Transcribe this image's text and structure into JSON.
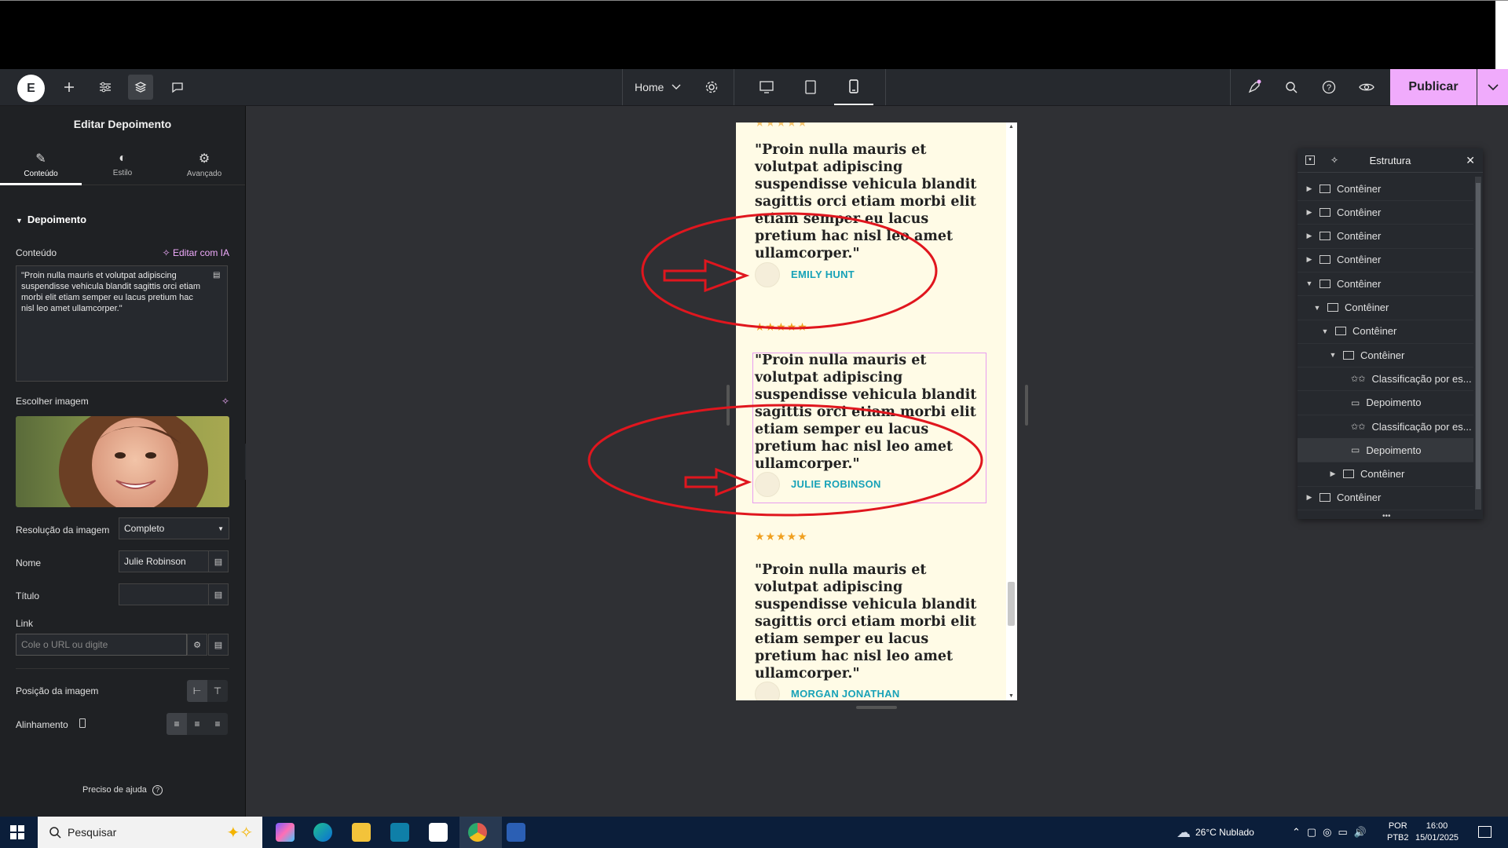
{
  "topbar": {
    "page_name": "Home",
    "publish_label": "Publicar"
  },
  "panel": {
    "title": "Editar Depoimento",
    "tabs": [
      "Conteúdo",
      "Estilo",
      "Avançado"
    ],
    "section": "Depoimento",
    "content_label": "Conteúdo",
    "ai_label": "Editar com IA",
    "content_value": "\"Proin nulla mauris et volutpat adipiscing suspendisse vehicula blandit sagittis orci etiam morbi elit etiam semper eu lacus pretium hac nisl leo amet ullamcorper.\"",
    "image_label": "Escolher imagem",
    "resolution_label": "Resolução da imagem",
    "resolution_value": "Completo",
    "name_label": "Nome",
    "name_value": "Julie Robinson",
    "title_label": "Título",
    "title_value": "",
    "link_label": "Link",
    "link_placeholder": "Cole o URL ou digite",
    "image_position_label": "Posição da imagem",
    "alignment_label": "Alinhamento",
    "help_label": "Preciso de ajuda"
  },
  "preview": {
    "testimonials": [
      {
        "quote": "\"Proin nulla mauris et volutpat adipiscing suspendisse vehicula blandit sagittis orci etiam morbi elit etiam semper eu lacus pretium hac nisl leo amet ullamcorper.\"",
        "name": "EMILY HUNT"
      },
      {
        "quote": "\"Proin nulla mauris et volutpat adipiscing suspendisse vehicula blandit sagittis orci etiam morbi elit etiam semper eu lacus pretium hac nisl leo amet ullamcorper.\"",
        "name": "JULIE ROBINSON"
      },
      {
        "quote": "\"Proin nulla mauris et volutpat adipiscing suspendisse vehicula blandit sagittis orci etiam morbi elit etiam semper eu lacus pretium hac nisl leo amet ullamcorper.\"",
        "name": "MORGAN JONATHAN"
      }
    ],
    "stars": "★★★★★"
  },
  "structure": {
    "title": "Estrutura",
    "items": [
      {
        "label": "Contêiner",
        "level": 0,
        "caret": "▶",
        "type": "container"
      },
      {
        "label": "Contêiner",
        "level": 0,
        "caret": "▶",
        "type": "container"
      },
      {
        "label": "Contêiner",
        "level": 0,
        "caret": "▶",
        "type": "container"
      },
      {
        "label": "Contêiner",
        "level": 0,
        "caret": "▶",
        "type": "container"
      },
      {
        "label": "Contêiner",
        "level": 0,
        "caret": "▼",
        "type": "container"
      },
      {
        "label": "Contêiner",
        "level": 1,
        "caret": "▼",
        "type": "container"
      },
      {
        "label": "Contêiner",
        "level": 2,
        "caret": "▼",
        "type": "container"
      },
      {
        "label": "Contêiner",
        "level": 3,
        "caret": "▼",
        "type": "container"
      },
      {
        "label": "Classificação por es...",
        "level": 4,
        "caret": "",
        "type": "rating"
      },
      {
        "label": "Depoimento",
        "level": 4,
        "caret": "",
        "type": "testimonial"
      },
      {
        "label": "Classificação por es...",
        "level": 4,
        "caret": "",
        "type": "rating"
      },
      {
        "label": "Depoimento",
        "level": 4,
        "caret": "",
        "type": "testimonial",
        "selected": true
      },
      {
        "label": "Contêiner",
        "level": 3,
        "caret": "▶",
        "type": "container"
      },
      {
        "label": "Contêiner",
        "level": 0,
        "caret": "▶",
        "type": "container"
      }
    ]
  },
  "taskbar": {
    "search_placeholder": "Pesquisar",
    "weather": "26°C  Nublado",
    "lang1": "POR",
    "lang2": "PTB2",
    "time": "16:00",
    "date": "15/01/2025"
  },
  "colors": {
    "accent": "#f0abfc",
    "name_color": "#17a2b8",
    "annotation": "#e0161e"
  }
}
